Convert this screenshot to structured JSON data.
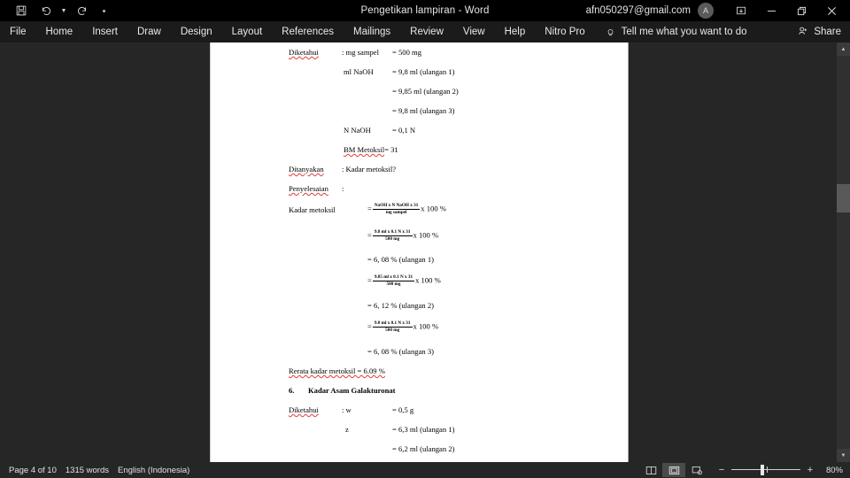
{
  "window": {
    "title": "Pengetikan lampiran  -  Word",
    "account": "afn050297@gmail.com",
    "avatar_initial": "A",
    "quick_access": [
      {
        "name": "save-button",
        "label": "Save"
      },
      {
        "name": "undo-button",
        "label": "Undo"
      },
      {
        "name": "redo-button",
        "label": "Redo"
      },
      {
        "name": "customize-quick-access-button",
        "label": "Customize Quick Access Toolbar"
      }
    ],
    "controls": [
      {
        "name": "ribbon-display-options-button",
        "label": "Ribbon Display Options"
      },
      {
        "name": "minimize-button",
        "label": "Minimize"
      },
      {
        "name": "restore-button",
        "label": "Restore Down"
      },
      {
        "name": "close-button",
        "label": "Close"
      }
    ]
  },
  "ribbon": {
    "tabs": [
      {
        "label": "File"
      },
      {
        "label": "Home"
      },
      {
        "label": "Insert"
      },
      {
        "label": "Draw"
      },
      {
        "label": "Design"
      },
      {
        "label": "Layout"
      },
      {
        "label": "References"
      },
      {
        "label": "Mailings"
      },
      {
        "label": "Review"
      },
      {
        "label": "View"
      },
      {
        "label": "Help"
      },
      {
        "label": "Nitro Pro"
      }
    ],
    "tell_me": "Tell me what you want to do",
    "share": "Share"
  },
  "document": {
    "lines": {
      "l1_label": "Diketahui",
      "l1_key": ": mg sampel",
      "l1_val": "= 500 mg",
      "l2_key": "ml NaOH",
      "l2_val": "= 9,8 ml (ulangan 1)",
      "l3_val": "= 9,85 ml (ulangan 2)",
      "l4_val": "= 9,8 ml (ulangan 3)",
      "l5_key": "N NaOH",
      "l5_val": "= 0,1 N",
      "l6_key": "BM Metoksil",
      "l6_val": "= 31",
      "l7_label": "Ditanyakan",
      "l7_val": ": Kadar metoksil?",
      "l8_label": "Penyelesaian",
      "l8_val": ":",
      "l9_label": "Kadar metoksil",
      "f1_num": "NaOH x N NaOH x 31",
      "f1_den": "mg sampel",
      "f1_tail": "x 100 %",
      "f2_num": "9.8 ml x 0.1 N x 31",
      "f2_den": "500 mg",
      "f2_tail": "x 100 %",
      "r1": "= 6, 08 % (ulangan 1)",
      "f3_num": "9.85 ml x 0.1 N x 31",
      "f3_den": "500 mg",
      "f3_tail": "x 100 %",
      "r2": "= 6, 12 % (ulangan 2)",
      "f4_num": "9.8 ml x 0.1 N x 31",
      "f4_den": "500 mg",
      "f4_tail": "x 100 %",
      "r3": "= 6, 08 % (ulangan 3)",
      "avg": "Rerata kadar metoksil = 6.09 %",
      "heading_num": "6.",
      "heading_text": "Kadar Asam Galakturonat",
      "l10_label": "Diketahui",
      "l10_key": ": w",
      "l10_val": "= 0,5 g",
      "l11_key": "z",
      "l11_val": "= 6,3 ml (ulangan 1)",
      "l12_val": "= 6,2 ml (ulangan 2)",
      "eq": "="
    }
  },
  "status": {
    "page": "Page 4 of 10",
    "words": "1315 words",
    "language": "English (Indonesia)",
    "views": [
      {
        "name": "read-mode-button",
        "label": "Read Mode"
      },
      {
        "name": "print-layout-button",
        "label": "Print Layout"
      },
      {
        "name": "web-layout-button",
        "label": "Web Layout"
      }
    ],
    "zoom_out": "−",
    "zoom_in": "+",
    "zoom_level": "80%"
  }
}
